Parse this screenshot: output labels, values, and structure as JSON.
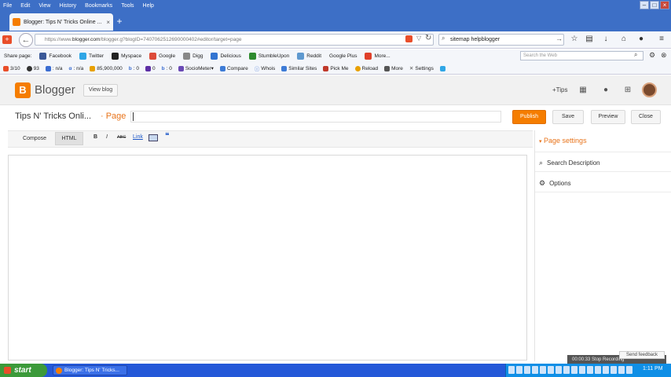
{
  "browser": {
    "menu": [
      "File",
      "Edit",
      "View",
      "History",
      "Bookmarks",
      "Tools",
      "Help"
    ],
    "tab_title": "Blogger: Tips N' Tricks Online ...",
    "url_prefix": "https://www.",
    "url_host": "blogger.com",
    "url_rest": "/blogger.g?blogID=7407062512690000402#editor/target=page",
    "search_value": "sitemap helpblogger",
    "web_search_placeholder": "Search the Web"
  },
  "share_bar": {
    "label": "Share page:",
    "items": [
      {
        "label": "Facebook",
        "color": "#3b5998"
      },
      {
        "label": "Twitter",
        "color": "#2fa6e6"
      },
      {
        "label": "Myspace",
        "color": "#222222"
      },
      {
        "label": "Google",
        "color": "#dd4b39"
      },
      {
        "label": "Digg",
        "color": "#666666"
      },
      {
        "label": "Delicious",
        "color": "#3274d1"
      },
      {
        "label": "StumbleUpon",
        "color": "#2e8b2e"
      },
      {
        "label": "Reddit",
        "color": "#5f99cf"
      },
      {
        "label": "Google Plus",
        "color": "#ffffff"
      },
      {
        "label": "More...",
        "color": "#e0402a"
      }
    ]
  },
  "seo_bar": {
    "items": [
      "3/10",
      "93",
      ": n/a",
      ": n/a",
      "85,900,000",
      ": 0",
      "0",
      ": 0",
      "SocioMeter▾",
      "Compare",
      "Whois",
      "Similar Sites",
      "Pick Me",
      "Reload",
      "More",
      "Settings"
    ]
  },
  "blogger": {
    "brand": "Blogger",
    "view_blog": "View blog",
    "tips": "+Tips",
    "blog_title": "Tips N' Tricks Onli...",
    "page_label": "· Page",
    "buttons": {
      "publish": "Publish",
      "save": "Save",
      "preview": "Preview",
      "close": "Close"
    },
    "modes": {
      "compose": "Compose",
      "html": "HTML"
    },
    "tools": {
      "bold": "B",
      "italic": "I",
      "strike": "ABC",
      "link": "Link",
      "quote": "❝"
    },
    "panel": {
      "title": "Page settings",
      "items": [
        "Search Description",
        "Options"
      ]
    }
  },
  "overlay": {
    "recording": "00:00:33   Stop Recording",
    "feedback": "Send feedback"
  },
  "taskbar": {
    "start": "start",
    "task": "Blogger: Tips N' Tricks...",
    "clock": "1:11 PM"
  }
}
